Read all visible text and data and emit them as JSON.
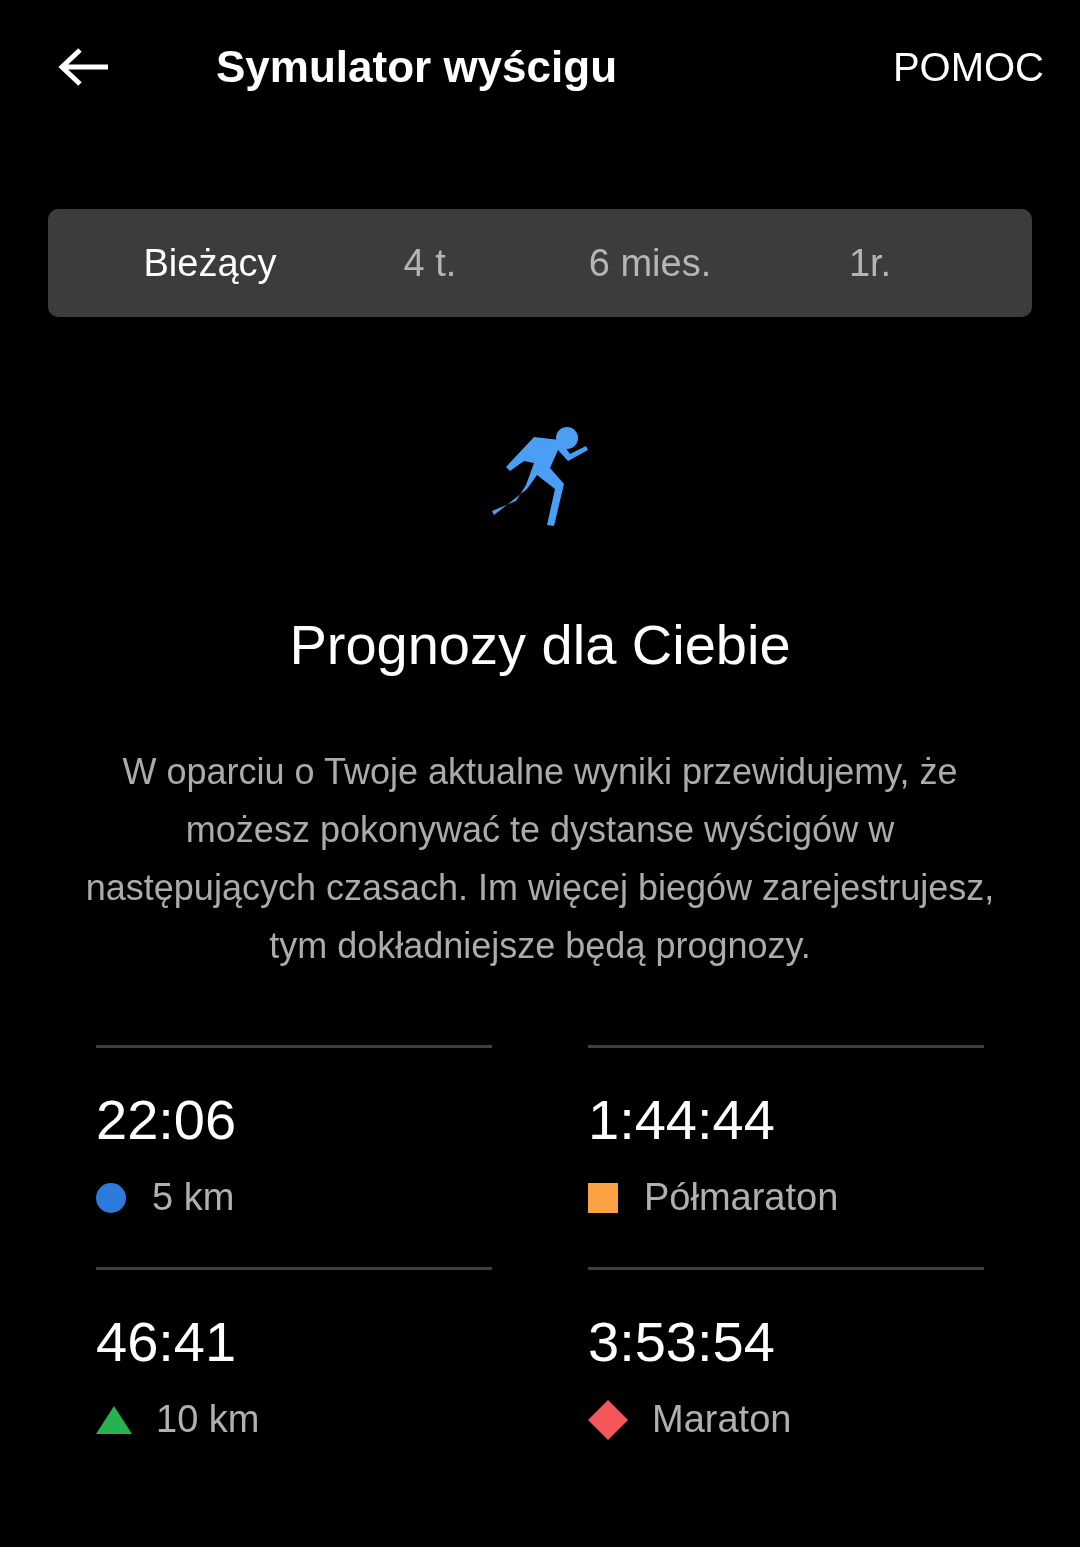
{
  "header": {
    "title": "Symulator wyścigu",
    "action": "POMOC"
  },
  "tabs": [
    {
      "label": "Bieżący",
      "selected": true
    },
    {
      "label": "4 t.",
      "selected": false
    },
    {
      "label": "6 mies.",
      "selected": false
    },
    {
      "label": "1r.",
      "selected": false
    }
  ],
  "heading": "Prognozy dla Ciebie",
  "description": "W oparciu o Twoje aktualne wyniki przewidujemy, że możesz pokonywać te dystanse wyścigów w następujących czasach. Im więcej biegów zarejestrujesz, tym dokładniejsze będą prognozy.",
  "predictions": [
    {
      "time": "22:06",
      "distance": "5 km",
      "kind": "circle",
      "color": "#2a7bdc"
    },
    {
      "time": "1:44:44",
      "distance": "Półmaraton",
      "kind": "square",
      "color": "#fba243"
    },
    {
      "time": "46:41",
      "distance": "10 km",
      "kind": "triangle",
      "color": "#27b14f"
    },
    {
      "time": "3:53:54",
      "distance": "Maraton",
      "kind": "diamond",
      "color": "#f55659"
    }
  ]
}
